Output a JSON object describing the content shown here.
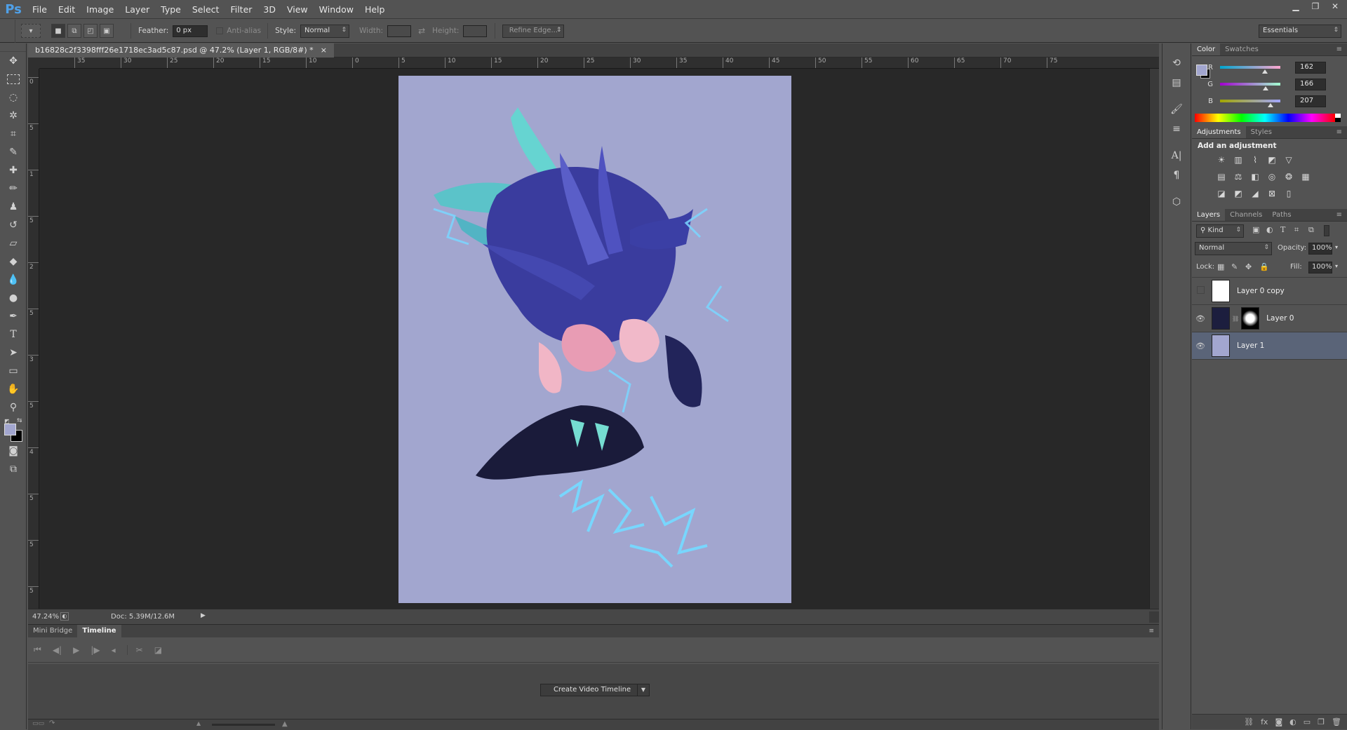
{
  "app": {
    "logo": "Ps",
    "menu": [
      "File",
      "Edit",
      "Image",
      "Layer",
      "Type",
      "Select",
      "Filter",
      "3D",
      "View",
      "Window",
      "Help"
    ]
  },
  "options": {
    "feather_label": "Feather:",
    "feather_value": "0 px",
    "antialias_label": "Anti-alias",
    "style_label": "Style:",
    "style_value": "Normal",
    "width_label": "Width:",
    "height_label": "Height:",
    "refine_edge": "Refine Edge...",
    "workspace": "Essentials"
  },
  "document": {
    "tab_title": "b16828c2f3398fff26e1718ec3ad5c87.psd @ 47.2% (Layer 1, RGB/8#) *",
    "close": "×",
    "ruler_h": [
      "35",
      "30",
      "25",
      "20",
      "15",
      "10",
      "0",
      "5",
      "10",
      "15",
      "20",
      "25",
      "30",
      "35",
      "40",
      "45",
      "50",
      "55",
      "60",
      "65",
      "70",
      "75"
    ],
    "ruler_v": [
      "0",
      "5",
      "1",
      "5",
      "2",
      "5",
      "3",
      "5",
      "4",
      "5",
      "5",
      "5"
    ],
    "zoom": "47.24%",
    "doc_info": "Doc: 5.39M/12.6M"
  },
  "bottom_panel": {
    "tabs": [
      "Mini Bridge",
      "Timeline"
    ],
    "active_tab": "Timeline",
    "create_video_timeline": "Create Video Timeline"
  },
  "color_panel": {
    "tabs": [
      "Color",
      "Swatches"
    ],
    "r_label": "R",
    "g_label": "G",
    "b_label": "B",
    "r": "162",
    "g": "166",
    "b": "207",
    "fg_color": "#a2a6cf",
    "bg_color": "#000000"
  },
  "adjustments_panel": {
    "tabs": [
      "Adjustments",
      "Styles"
    ],
    "heading": "Add an adjustment"
  },
  "layers_panel": {
    "tabs": [
      "Layers",
      "Channels",
      "Paths"
    ],
    "filter": "Kind",
    "blend_mode": "Normal",
    "opacity_label": "Opacity:",
    "opacity": "100%",
    "lock_label": "Lock:",
    "fill_label": "Fill:",
    "fill": "100%",
    "layers": [
      {
        "name": "Layer 0 copy",
        "visible": false,
        "selected": false
      },
      {
        "name": "Layer 0",
        "visible": true,
        "selected": false
      },
      {
        "name": "Layer 1",
        "visible": true,
        "selected": true
      }
    ]
  }
}
